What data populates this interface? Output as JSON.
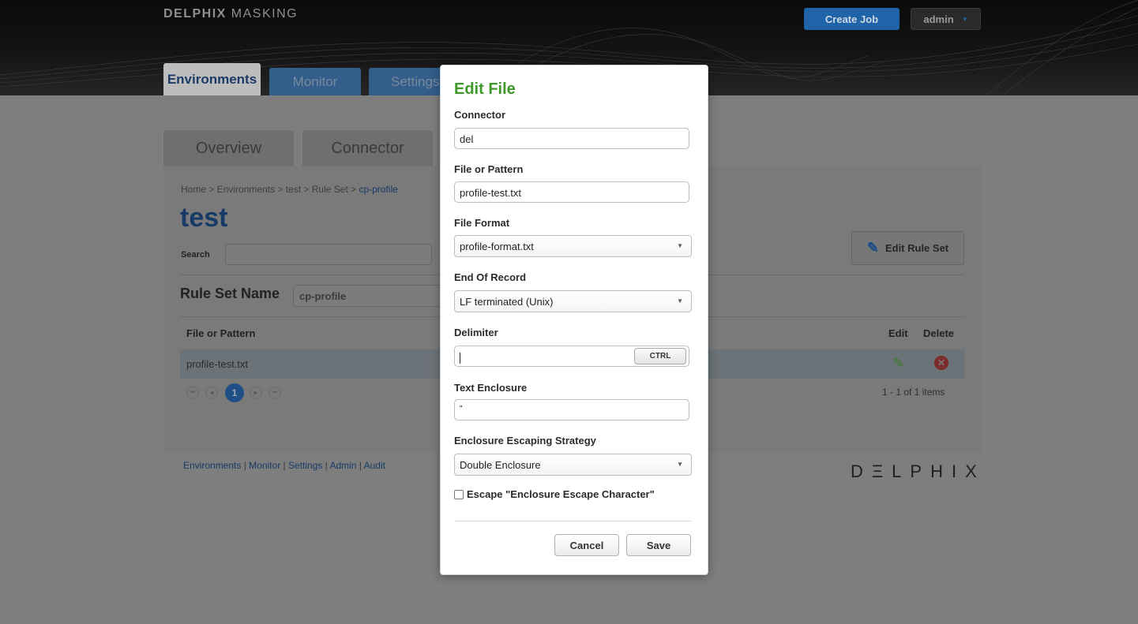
{
  "header": {
    "logo_bold": "DELPHIX",
    "logo_light": " MASKING",
    "create_job": "Create Job",
    "user": "admin"
  },
  "main_tabs": [
    "Environments",
    "Monitor",
    "Settings"
  ],
  "sub_tabs": [
    "Overview",
    "Connector"
  ],
  "breadcrumb": {
    "path": "Home > Environments > test > Rule Set > ",
    "current": "cp-profile"
  },
  "page_title": "test",
  "search": {
    "label": "Search",
    "value": ""
  },
  "edit_rule_set": "Edit Rule Set",
  "rule_set": {
    "label": "Rule Set Name",
    "value": "cp-profile"
  },
  "table": {
    "headers": {
      "file": "File or Pattern",
      "edit": "Edit",
      "delete": "Delete"
    },
    "rows": [
      {
        "file": "profile-test.txt"
      }
    ]
  },
  "pagination": {
    "current_page": "1",
    "summary": "1 - 1 of 1 items"
  },
  "footer": {
    "links": [
      "Environments",
      "Monitor",
      "Settings",
      "Admin",
      "Audit"
    ],
    "brand": "DΞLPHIX"
  },
  "modal": {
    "title": "Edit File",
    "connector": {
      "label": "Connector",
      "value": "del"
    },
    "file_pattern": {
      "label": "File or Pattern",
      "value": "profile-test.txt"
    },
    "file_format": {
      "label": "File Format",
      "value": "profile-format.txt"
    },
    "end_of_record": {
      "label": "End Of Record",
      "value": "LF terminated (Unix)"
    },
    "delimiter": {
      "label": "Delimiter",
      "value": "",
      "ctrl": "CTRL"
    },
    "text_enclosure": {
      "label": "Text Enclosure",
      "value": "\""
    },
    "escaping_strategy": {
      "label": "Enclosure Escaping Strategy",
      "value": "Double Enclosure"
    },
    "escape_checkbox": {
      "label": "Escape \"Enclosure Escape Character\"",
      "checked": false
    },
    "cancel": "Cancel",
    "save": "Save"
  },
  "colors": {
    "accent_green": "#3d9a2a",
    "brand_blue": "#1f64a8",
    "title_blue": "#173a66"
  }
}
